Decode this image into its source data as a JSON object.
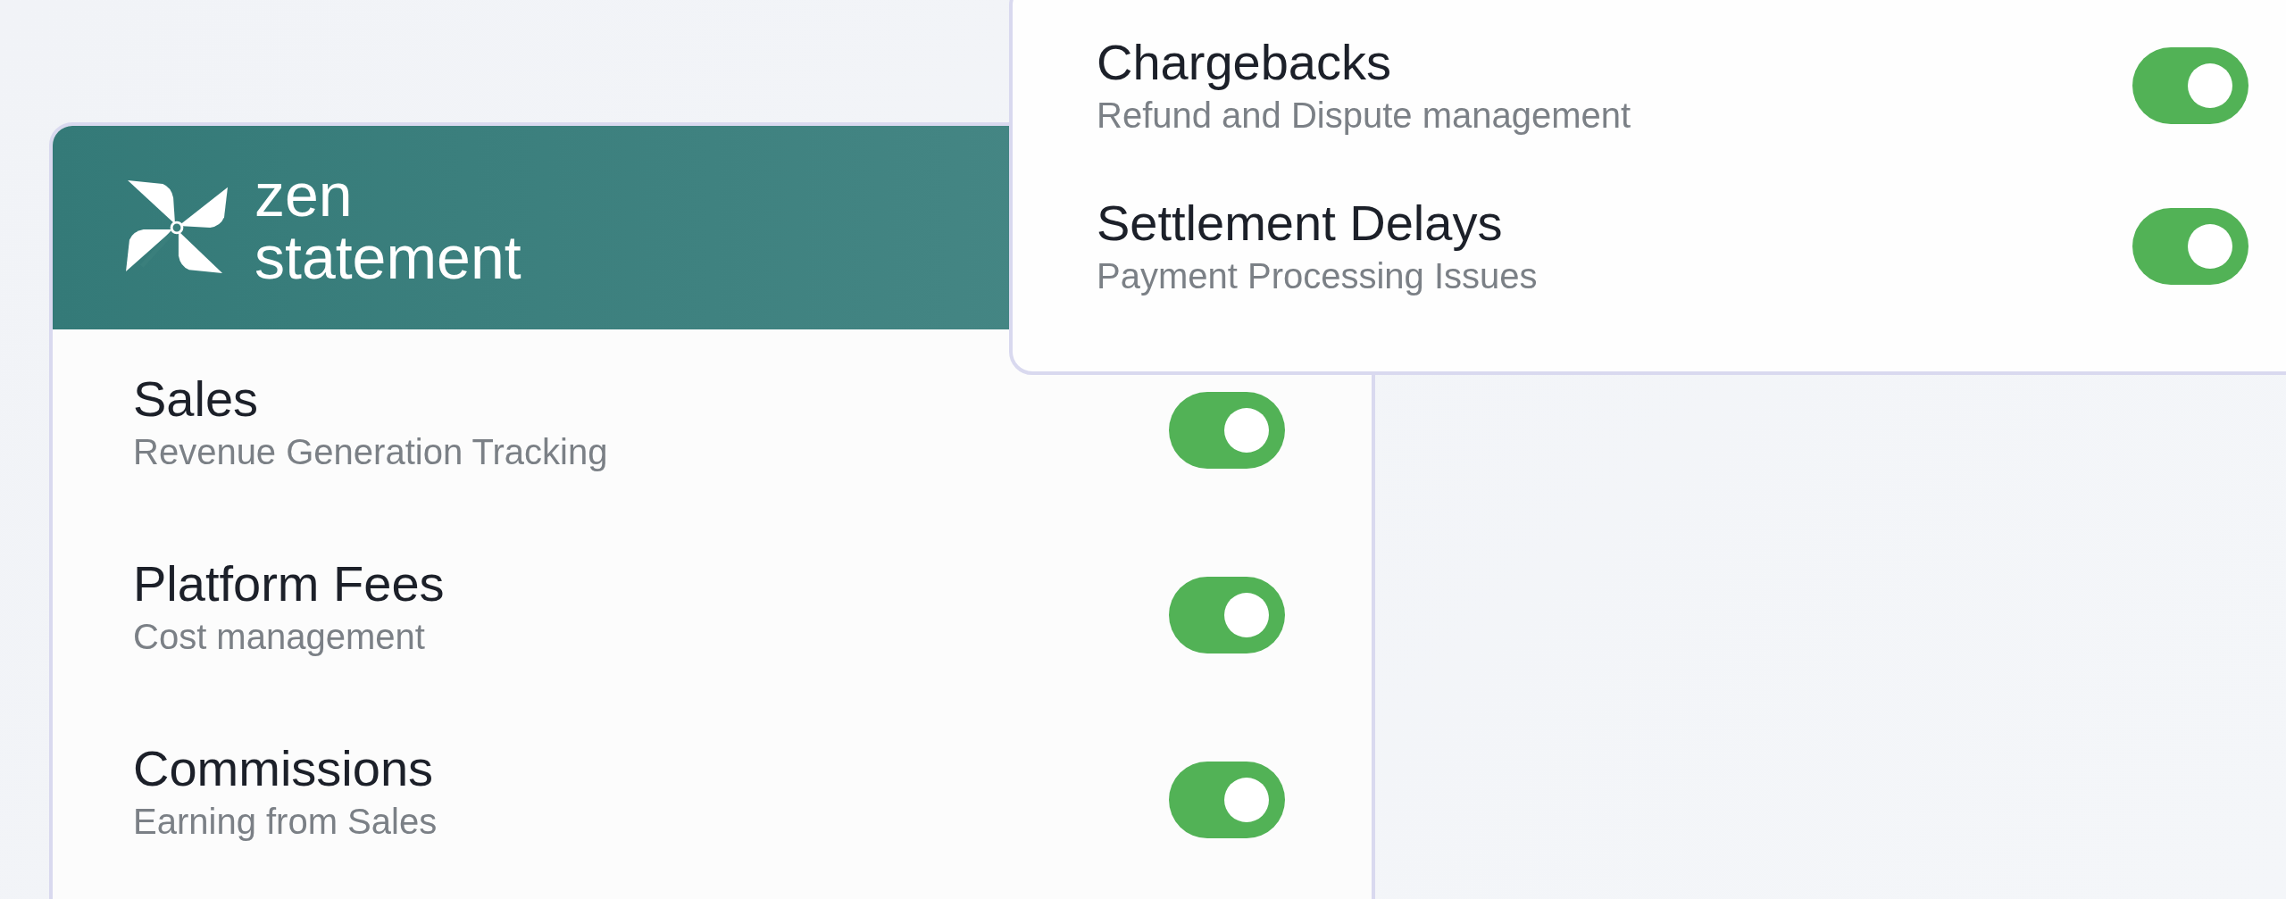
{
  "logo": {
    "lines": [
      "zen",
      "statement"
    ]
  },
  "main_card": {
    "items": [
      {
        "title": "Sales",
        "subtitle": "Revenue Generation Tracking",
        "on": true
      },
      {
        "title": "Platform Fees",
        "subtitle": "Cost management",
        "on": true
      },
      {
        "title": "Commissions",
        "subtitle": "Earning from Sales",
        "on": true
      }
    ]
  },
  "overlay_card": {
    "items": [
      {
        "title": "Chargebacks",
        "subtitle": "Refund and Dispute management",
        "on": true
      },
      {
        "title": "Settlement Delays",
        "subtitle": "Payment Processing Issues",
        "on": true
      }
    ]
  }
}
